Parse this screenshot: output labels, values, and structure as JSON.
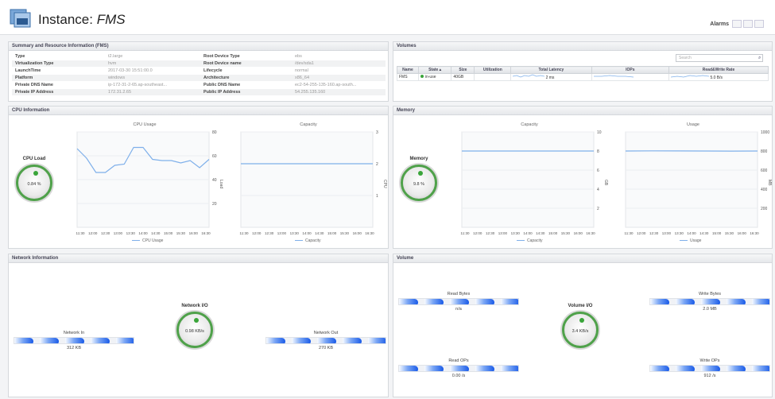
{
  "header": {
    "title_prefix": "Instance: ",
    "title_name": "FMS",
    "alarms_label": "Alarms"
  },
  "summary": {
    "title": "Summary and Resource Information (FMS)",
    "rows": [
      {
        "k1": "Type",
        "v1": "t2.large",
        "k2": "Root Device Type",
        "v2": "ebs"
      },
      {
        "k1": "Virtualization Type",
        "v1": "hvm",
        "k2": "Root Device name",
        "v2": "/dev/sda1"
      },
      {
        "k1": "LaunchTime",
        "v1": "2017-03-30 15:51:00.0",
        "k2": "Lifecycle",
        "v2": "normal"
      },
      {
        "k1": "Platform",
        "v1": "windows",
        "k2": "Architecture",
        "v2": "x86_64"
      },
      {
        "k1": "Private DNS Name",
        "v1": "ip-172-31-2-65.ap-southeast...",
        "k2": "Public DNS Name",
        "v2": "ec2-54-255-135-160.ap-south..."
      },
      {
        "k1": "Private IP Address",
        "v1": "172.31.2.65",
        "k2": "Public IP Address",
        "v2": "54.255.135.160"
      }
    ]
  },
  "volumes": {
    "title": "Volumes",
    "search_placeholder": "Search",
    "columns": [
      "Name",
      "State ▴",
      "Size",
      "Utilization",
      "Total Latency",
      "IOPs",
      "Read&Write Rate"
    ],
    "rows": [
      {
        "name": "FMS",
        "state": "in-use",
        "size": "40GB",
        "utilization": "",
        "latency": "2 ms",
        "iops": "",
        "rate": "5.0 B/s"
      }
    ]
  },
  "cpu": {
    "title": "CPU Information",
    "gauge_label": "CPU Load",
    "gauge_value": "0.84 %",
    "usage_title": "CPU Usage",
    "usage_legend": "CPU Usage",
    "usage_axis": "Load",
    "capacity_title": "Capacity",
    "capacity_legend": "Capacity",
    "capacity_axis": "CPU"
  },
  "memory": {
    "title": "Memory",
    "gauge_label": "Memory",
    "gauge_value": "9.8 %",
    "capacity_title": "Capacity",
    "capacity_legend": "Capacity",
    "capacity_axis": "GB",
    "usage_title": "Usage",
    "usage_legend": "Usage",
    "usage_axis": "MB"
  },
  "network": {
    "title": "Network Information",
    "gauge_label": "Network I/O",
    "gauge_value": "0.98 KB/s",
    "in_label": "Network In",
    "in_value": "312 KB",
    "out_label": "Network Out",
    "out_value": "270 KB"
  },
  "volume_io": {
    "title": "Volume",
    "gauge_label": "Volume I/O",
    "gauge_value": "3.4 KB/s",
    "read_bytes_label": "Read Bytes",
    "read_bytes_value": "n/a",
    "write_bytes_label": "Write Bytes",
    "write_bytes_value": "2.0 MB",
    "read_ops_label": "Read OPs",
    "read_ops_value": "0.00 /s",
    "write_ops_label": "Write OPs",
    "write_ops_value": "912 /s"
  },
  "colors": {
    "line": "#7fb0ea",
    "gauge_ring": "#4fa14a",
    "bar_fill": "#1a5be8"
  },
  "chart_data": [
    {
      "type": "line",
      "title": "CPU Usage",
      "x": [
        "11:30",
        "12:00",
        "12:30",
        "13:00",
        "13:30",
        "14:00",
        "14:30",
        "15:00",
        "15:30",
        "16:00",
        "16:30"
      ],
      "series": [
        {
          "name": "CPU Usage",
          "values": [
            66,
            58,
            46,
            46,
            52,
            53,
            67,
            67,
            57,
            56,
            56,
            54,
            56,
            50,
            57
          ]
        }
      ],
      "ylabel": "Load",
      "ylim": [
        0,
        80
      ],
      "yticks": [
        20,
        40,
        60,
        80
      ]
    },
    {
      "type": "line",
      "title": "Capacity",
      "x": [
        "11:30",
        "12:00",
        "12:30",
        "13:00",
        "13:30",
        "14:00",
        "14:30",
        "15:00",
        "15:30",
        "16:00",
        "16:30"
      ],
      "series": [
        {
          "name": "Capacity",
          "values": [
            2,
            2
          ]
        }
      ],
      "ylabel": "CPU",
      "ylim": [
        0,
        3
      ],
      "yticks": [
        1,
        2,
        3
      ]
    },
    {
      "type": "line",
      "title": "Capacity",
      "x": [
        "11:30",
        "12:00",
        "12:30",
        "13:00",
        "13:30",
        "14:00",
        "14:30",
        "15:00",
        "15:30",
        "16:00",
        "16:30"
      ],
      "series": [
        {
          "name": "Capacity",
          "values": [
            8,
            8
          ]
        }
      ],
      "ylabel": "GB",
      "ylim": [
        0,
        10
      ],
      "yticks": [
        2,
        4,
        6,
        8,
        10
      ]
    },
    {
      "type": "line",
      "title": "Usage",
      "x": [
        "11:30",
        "12:00",
        "12:30",
        "13:00",
        "13:30",
        "14:00",
        "14:30",
        "15:00",
        "15:30",
        "16:00",
        "16:30"
      ],
      "series": [
        {
          "name": "Usage",
          "values": [
            800,
            802,
            801,
            800,
            799,
            800
          ]
        }
      ],
      "ylabel": "MB",
      "ylim": [
        0,
        1000
      ],
      "yticks": [
        200,
        400,
        600,
        800,
        1000
      ]
    }
  ]
}
